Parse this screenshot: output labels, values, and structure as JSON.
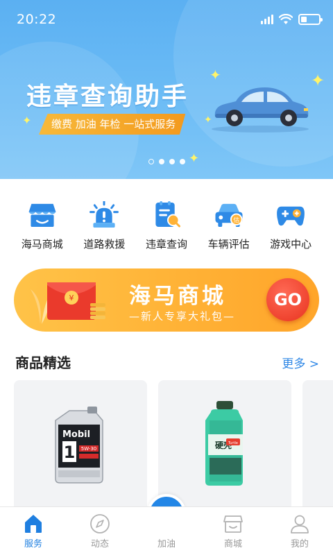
{
  "status_bar": {
    "time": "20:22"
  },
  "banner": {
    "title": "违章查询助手",
    "subtitle": "缴费 加油 年检 一站式服务",
    "dots_count": 4,
    "active_dot": 0
  },
  "quick_menu": [
    {
      "label": "海马商城",
      "icon": "store-icon"
    },
    {
      "label": "道路救援",
      "icon": "alarm-light-icon"
    },
    {
      "label": "违章查询",
      "icon": "ticket-search-icon"
    },
    {
      "label": "车辆评估",
      "icon": "car-valuation-icon"
    },
    {
      "label": "游戏中心",
      "icon": "gamepad-icon"
    }
  ],
  "promo": {
    "title": "海马商城",
    "subtitle": "—新人专享大礼包—",
    "go_label": "GO",
    "red_envelope_text": "¥"
  },
  "products_section": {
    "title": "商品精选",
    "more_label": "更多 >",
    "items": [
      {
        "brand": "Mobil",
        "number": "1",
        "spec": "5W-30"
      },
      {
        "brand": "硬壳",
        "badge": "Turtle"
      }
    ]
  },
  "tabbar": {
    "tabs": [
      {
        "label": "服务",
        "icon": "home-icon",
        "active": true
      },
      {
        "label": "动态",
        "icon": "compass-icon",
        "active": false
      },
      {
        "label": "加油",
        "icon": "fuel-icon",
        "active": false
      },
      {
        "label": "商城",
        "icon": "shop-icon",
        "active": false
      },
      {
        "label": "我的",
        "icon": "user-icon",
        "active": false
      }
    ]
  },
  "colors": {
    "primary": "#1f7fe0",
    "banner_blue": "#5bb0f2",
    "promo_orange": "#ffb236",
    "go_red": "#e8331f",
    "more_link": "#2e87e6"
  }
}
